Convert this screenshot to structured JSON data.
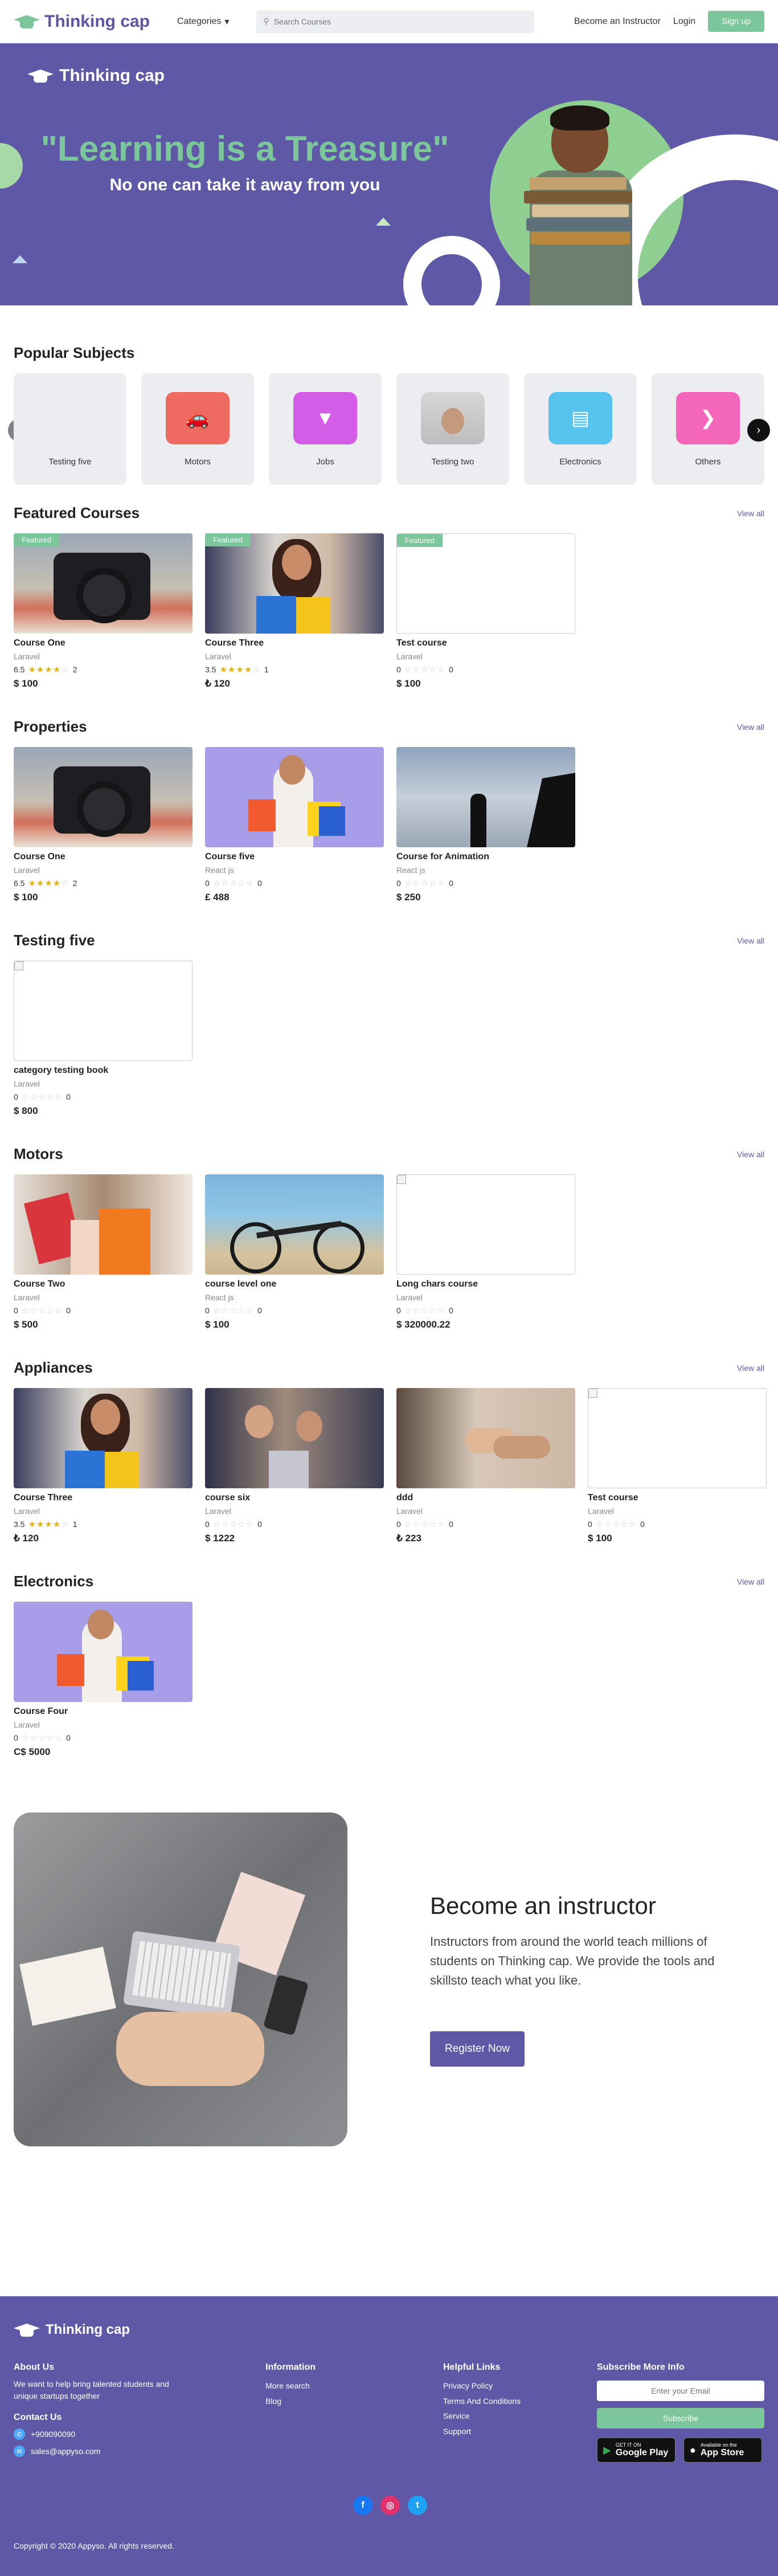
{
  "nav": {
    "logo": "Thinking cap",
    "categories": "Categories",
    "search_placeholder": "Search Courses",
    "become_instructor": "Become an Instructor",
    "login": "Login",
    "signup": "Sign up"
  },
  "hero": {
    "brand": "Thinking cap",
    "title": "\"Learning is a Treasure\"",
    "subtitle": "No one can take it away from you"
  },
  "popular": {
    "title": "Popular Subjects",
    "subjects": [
      {
        "label": "Testing five",
        "icon": "empty-icon",
        "color": "#ebedf0"
      },
      {
        "label": "Motors",
        "icon": "car-icon",
        "color": "#ef6b61"
      },
      {
        "label": "Jobs",
        "icon": "tie-icon",
        "color": "#d45de7"
      },
      {
        "label": "Testing two",
        "icon": "person-photo",
        "color": "#d9d9d9"
      },
      {
        "label": "Electronics",
        "icon": "printer-icon",
        "color": "#57c4ef"
      },
      {
        "label": "Others",
        "icon": "chevron-right-icon",
        "color": "#f466b9"
      }
    ]
  },
  "featured": {
    "title": "Featured Courses",
    "view_all": "View all",
    "badge": "Featured",
    "courses": [
      {
        "title": "Course One",
        "author": "Laravel",
        "rating": "6.5",
        "stars": 4,
        "count": "2",
        "price": "$ 100",
        "art": "camera"
      },
      {
        "title": "Course Three",
        "author": "Laravel",
        "rating": "3.5",
        "stars": 4,
        "count": "1",
        "price": "₺ 120",
        "art": "shopping"
      },
      {
        "title": "Test course",
        "author": "Laravel",
        "rating": "0",
        "stars": 0,
        "count": "0",
        "price": "$ 100",
        "art": "empty"
      }
    ]
  },
  "properties": {
    "title": "Properties",
    "view_all": "View all",
    "courses": [
      {
        "title": "Course One",
        "author": "Laravel",
        "rating": "6.5",
        "stars": 4,
        "count": "2",
        "price": "$ 100",
        "art": "camera"
      },
      {
        "title": "Course five",
        "author": "React js",
        "rating": "0",
        "stars": 0,
        "count": "0",
        "price": "£ 488",
        "art": "purple"
      },
      {
        "title": "Course for Animation",
        "author": "React js",
        "rating": "0",
        "stars": 0,
        "count": "0",
        "price": "$ 250",
        "art": "silhouette"
      }
    ]
  },
  "testing_five": {
    "title": "Testing five",
    "view_all": "View all",
    "courses": [
      {
        "title": "category testing book",
        "author": "Laravel",
        "rating": "0",
        "stars": 0,
        "count": "0",
        "price": "$ 800",
        "art": "broken"
      }
    ]
  },
  "motors": {
    "title": "Motors",
    "view_all": "View all",
    "courses": [
      {
        "title": "Course Two",
        "author": "Laravel",
        "rating": "0",
        "stars": 0,
        "count": "0",
        "price": "$ 500",
        "art": "bags"
      },
      {
        "title": "course level one",
        "author": "React js",
        "rating": "0",
        "stars": 0,
        "count": "0",
        "price": "$ 100",
        "art": "bike"
      },
      {
        "title": "Long chars course",
        "author": "Laravel",
        "rating": "0",
        "stars": 0,
        "count": "0",
        "price": "$ 320000.22",
        "art": "broken"
      }
    ]
  },
  "appliances": {
    "title": "Appliances",
    "view_all": "View all",
    "courses": [
      {
        "title": "Course Three",
        "author": "Laravel",
        "rating": "3.5",
        "stars": 4,
        "count": "1",
        "price": "₺ 120",
        "art": "shopping"
      },
      {
        "title": "course six",
        "author": "Laravel",
        "rating": "0",
        "stars": 0,
        "count": "0",
        "price": "$ 1222",
        "art": "mall"
      },
      {
        "title": "ddd",
        "author": "Laravel",
        "rating": "0",
        "stars": 0,
        "count": "0",
        "price": "₺ 223",
        "art": "hand"
      },
      {
        "title": "Test course",
        "author": "Laravel",
        "rating": "0",
        "stars": 0,
        "count": "0",
        "price": "$ 100",
        "art": "broken"
      }
    ]
  },
  "electronics": {
    "title": "Electronics",
    "view_all": "View all",
    "courses": [
      {
        "title": "Course Four",
        "author": "Laravel",
        "rating": "0",
        "stars": 0,
        "count": "0",
        "price": "C$ 5000",
        "art": "purple"
      }
    ]
  },
  "instructor": {
    "title": "Become an instructor",
    "description": "Instructors from around the world teach millions of students on Thinking cap. We provide the tools and skillsto teach what you like.",
    "button": "Register Now"
  },
  "footer": {
    "brand": "Thinking cap",
    "about_title": "About Us",
    "about_text": "We want to help bring talented students and unique startups together",
    "contact_title": "Contact Us",
    "phone": "+909090090",
    "email": "sales@appyso.com",
    "info_title": "Information",
    "info_links": [
      "More search",
      "Blog"
    ],
    "helpful_title": "Helpful Links",
    "helpful_links": [
      "Privacy Policy",
      "Terms And Conditions",
      "Service",
      "Support"
    ],
    "subscribe_title": "Subscribe More Info",
    "subscribe_placeholder": "Enter your Email",
    "subscribe_button": "Subscribe",
    "google_small": "GET IT ON",
    "google_big": "Google Play",
    "apple_small": "Available on the",
    "apple_big": "App Store",
    "copyright": "Copyright © 2020 Appyso. All rights reserved."
  }
}
